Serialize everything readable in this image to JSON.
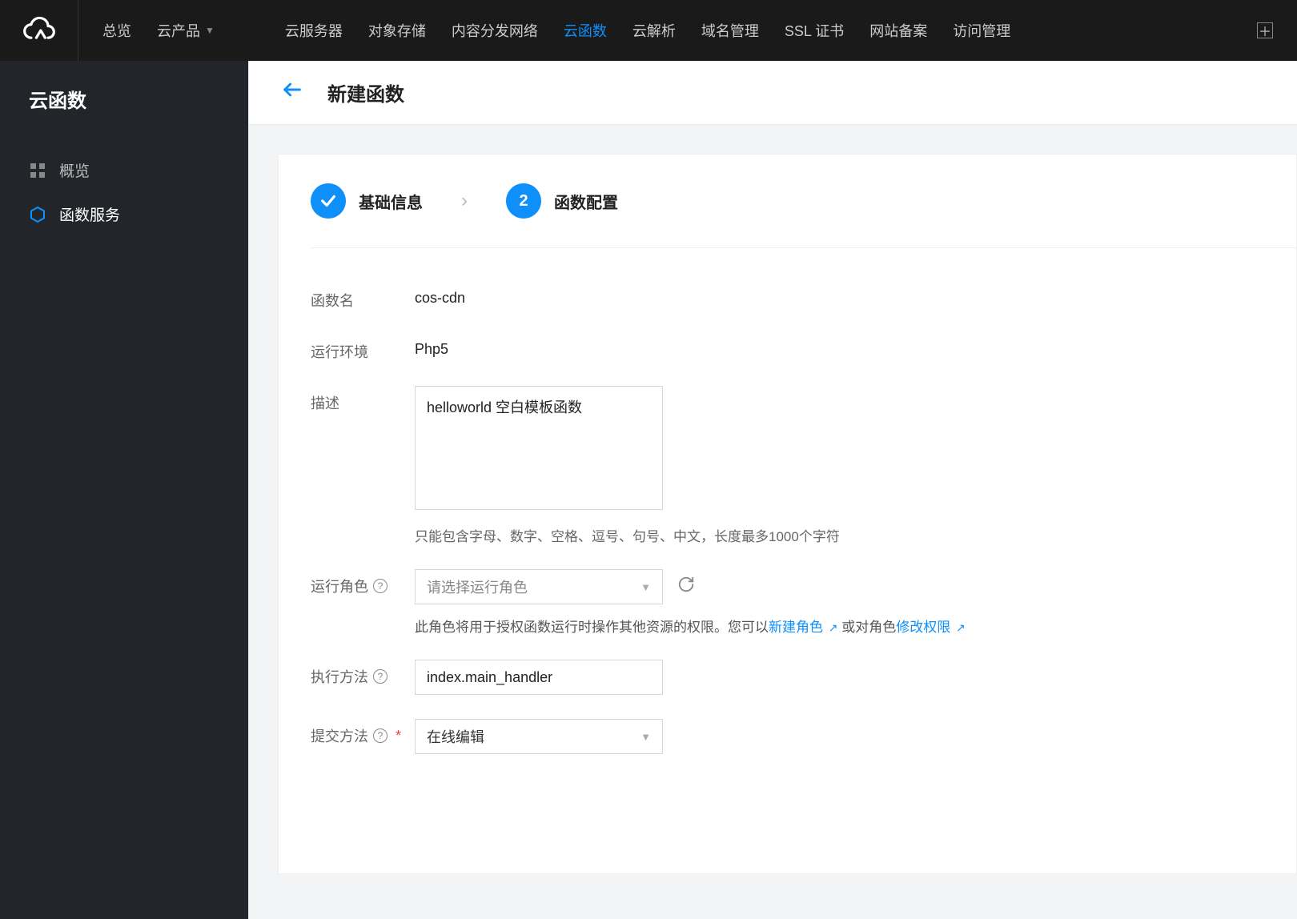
{
  "topnav": {
    "overview": "总览",
    "cloud_products": "云产品",
    "items": [
      "云服务器",
      "对象存储",
      "内容分发网络",
      "云函数",
      "云解析",
      "域名管理",
      "SSL 证书",
      "网站备案",
      "访问管理"
    ],
    "active_index": 3
  },
  "sidebar": {
    "title": "云函数",
    "items": [
      {
        "label": "概览",
        "icon": "grid"
      },
      {
        "label": "函数服务",
        "icon": "hex",
        "active": true
      }
    ]
  },
  "page": {
    "title": "新建函数"
  },
  "stepper": {
    "step1_label": "基础信息",
    "step2_num": "2",
    "step2_label": "函数配置"
  },
  "form": {
    "func_name_label": "函数名",
    "func_name_value": "cos-cdn",
    "runtime_label": "运行环境",
    "runtime_value": "Php5",
    "desc_label": "描述",
    "desc_value": "helloworld 空白模板函数",
    "desc_hint": "只能包含字母、数字、空格、逗号、句号、中文，长度最多1000个字符",
    "role_label": "运行角色",
    "role_placeholder": "请选择运行角色",
    "role_hint_prefix": "此角色将用于授权函数运行时操作其他资源的权限。您可以",
    "role_link1": "新建角色",
    "role_hint_mid": " 或对角色",
    "role_link2": "修改权限",
    "handler_label": "执行方法",
    "handler_value": "index.main_handler",
    "submit_label": "提交方法",
    "submit_value": "在线编辑"
  }
}
